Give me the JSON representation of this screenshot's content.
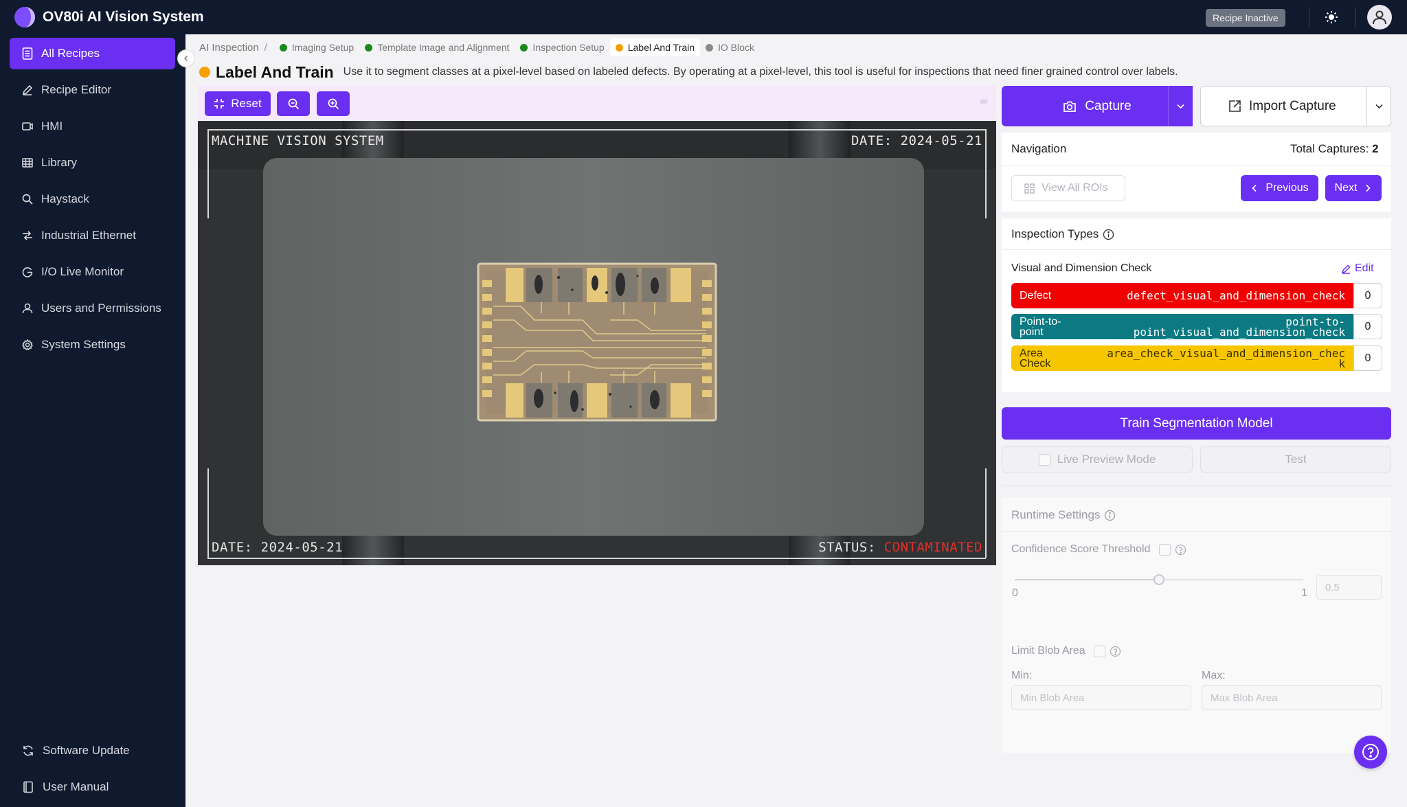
{
  "app": {
    "title": "OV80i AI Vision System",
    "recipe_status": "Recipe Inactive"
  },
  "sidebar": {
    "items": [
      {
        "label": "All Recipes",
        "icon": "recipes-icon",
        "active": true
      },
      {
        "label": "Recipe Editor",
        "icon": "edit-icon"
      },
      {
        "label": "HMI",
        "icon": "hmi-icon"
      },
      {
        "label": "Library",
        "icon": "library-icon"
      },
      {
        "label": "Haystack",
        "icon": "search-icon"
      },
      {
        "label": "Industrial Ethernet",
        "icon": "network-icon"
      },
      {
        "label": "I/O Live Monitor",
        "icon": "monitor-icon"
      },
      {
        "label": "Users and Permissions",
        "icon": "user-icon"
      },
      {
        "label": "System Settings",
        "icon": "gear-icon"
      }
    ],
    "bottom": [
      {
        "label": "Software Update",
        "icon": "refresh-icon"
      },
      {
        "label": "User Manual",
        "icon": "book-icon"
      }
    ]
  },
  "breadcrumb": {
    "root": "AI Inspection",
    "separator": "/",
    "steps": [
      {
        "label": "Imaging Setup",
        "color": "#1a8a1a"
      },
      {
        "label": "Template Image and Alignment",
        "color": "#1a8a1a"
      },
      {
        "label": "Inspection Setup",
        "color": "#1a8a1a"
      },
      {
        "label": "Label And Train",
        "color": "#f5a000",
        "active": true
      },
      {
        "label": "IO Block",
        "color": "#8a8a8a"
      }
    ]
  },
  "page": {
    "title": "Label And Train",
    "description": "Use it to segment classes at a pixel-level based on labeled defects. By operating at a pixel-level, this tool is useful for inspections that need finer grained control over labels."
  },
  "toolbar": {
    "reset_label": "Reset"
  },
  "image_overlay": {
    "top_left": "MACHINE VISION SYSTEM",
    "top_right": "DATE: 2024-05-21",
    "bottom_left": "DATE: 2024-05-21",
    "status_label": "STATUS:",
    "status_value": "CONTAMINATED"
  },
  "capture": {
    "capture_label": "Capture",
    "import_label": "Import Capture"
  },
  "navigation": {
    "title": "Navigation",
    "total_label": "Total Captures:",
    "total_value": "2",
    "view_all_label": "View All ROIs",
    "previous_label": "Previous",
    "next_label": "Next"
  },
  "inspection_types": {
    "title": "Inspection Types",
    "group_name": "Visual and Dimension Check",
    "edit_label": "Edit",
    "rows": [
      {
        "label": "Defect",
        "value": "defect_visual_and_dimension_check",
        "count": "0",
        "color": "#f00000"
      },
      {
        "label_line1": "Point-to-",
        "label_line2": "point",
        "value_line1": "point-to-",
        "value_line2": "point_visual_and_dimension_check",
        "count": "0",
        "color": "#0b7a82"
      },
      {
        "label_line1": "Area",
        "label_line2": "Check",
        "value_line1": "area_check_visual_and_dimension_chec",
        "value_line2": "k",
        "count": "0",
        "color": "#f7c600"
      }
    ]
  },
  "train": {
    "train_label": "Train Segmentation Model",
    "live_preview_label": "Live Preview Mode",
    "test_label": "Test"
  },
  "runtime": {
    "title": "Runtime Settings",
    "confidence_label": "Confidence Score Threshold",
    "slider_min": "0",
    "slider_max": "1",
    "slider_value": 0.5,
    "confidence_value": "0.5",
    "limit_blob_label": "Limit Blob Area",
    "min_label": "Min:",
    "max_label": "Max:",
    "min_placeholder": "Min Blob Area",
    "max_placeholder": "Max Blob Area"
  }
}
